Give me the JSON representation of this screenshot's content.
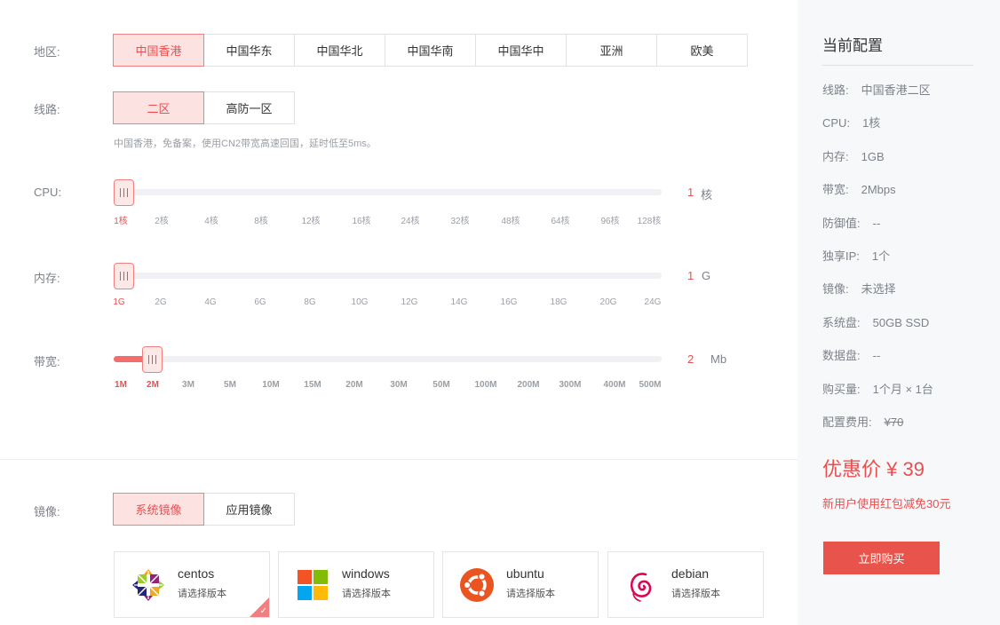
{
  "labels": {
    "region": "地区:",
    "line": "线路:",
    "cpu": "CPU:",
    "memory": "内存:",
    "bandwidth": "带宽:",
    "image": "镜像:"
  },
  "region_options": [
    "中国香港",
    "中国华东",
    "中国华北",
    "中国华南",
    "中国华中",
    "亚洲",
    "欧美"
  ],
  "region_selected": 0,
  "line_options": [
    "二区",
    "高防一区"
  ],
  "line_selected": 0,
  "line_hint": "中国香港，免备案，使用CN2带宽高速回国，延时低至5ms。",
  "cpu": {
    "ticks": [
      "1核",
      "2核",
      "4核",
      "8核",
      "12核",
      "16核",
      "24核",
      "32核",
      "48核",
      "64核",
      "96核",
      "128核"
    ],
    "selected_index": 0,
    "value": "1",
    "unit": "核"
  },
  "memory": {
    "ticks": [
      "1G",
      "2G",
      "4G",
      "6G",
      "8G",
      "10G",
      "12G",
      "14G",
      "16G",
      "18G",
      "20G",
      "24G"
    ],
    "selected_index": 0,
    "value": "1",
    "unit": "G"
  },
  "bandwidth": {
    "ticks": [
      "1M",
      "2M",
      "3M",
      "5M",
      "10M",
      "15M",
      "20M",
      "30M",
      "50M",
      "100M",
      "200M",
      "300M",
      "400M",
      "500M"
    ],
    "selected_index": 1,
    "value": "2",
    "unit": "Mb"
  },
  "image_tabs": [
    "系统镜像",
    "应用镜像"
  ],
  "image_tab_selected": 0,
  "os_cards": [
    {
      "name": "centos",
      "version": "请选择版本",
      "icon": "centos-logo-icon"
    },
    {
      "name": "windows",
      "version": "请选择版本",
      "icon": "windows-logo-icon"
    },
    {
      "name": "ubuntu",
      "version": "请选择版本",
      "icon": "ubuntu-logo-icon"
    },
    {
      "name": "debian",
      "version": "请选择版本",
      "icon": "debian-logo-icon"
    }
  ],
  "os_selected": 0,
  "check_mark": "✓",
  "summary": {
    "title": "当前配置",
    "items": [
      {
        "label": "线路:",
        "value": "中国香港二区"
      },
      {
        "label": "CPU:",
        "value": "1核"
      },
      {
        "label": "内存:",
        "value": "1GB"
      },
      {
        "label": "带宽:",
        "value": "2Mbps"
      },
      {
        "label": "防御值:",
        "value": "--"
      },
      {
        "label": "独享IP:",
        "value": "1个"
      },
      {
        "label": "镜像:",
        "value": "未选择"
      },
      {
        "label": "系统盘:",
        "value": "50GB SSD"
      },
      {
        "label": "数据盘:",
        "value": "--"
      },
      {
        "label": "购买量:",
        "value": "1个月 × 1台"
      },
      {
        "label": "配置费用:",
        "value": "¥70"
      }
    ],
    "price": "优惠价 ¥ 39",
    "promo": "新用户使用红包减免30元",
    "buy_label": "立即购买"
  },
  "colors": {
    "accent": "#ea4f4f",
    "accent_light": "#fde2e2",
    "sidebar_bg": "#f7f8fa",
    "buy_button": "#e8534b"
  }
}
